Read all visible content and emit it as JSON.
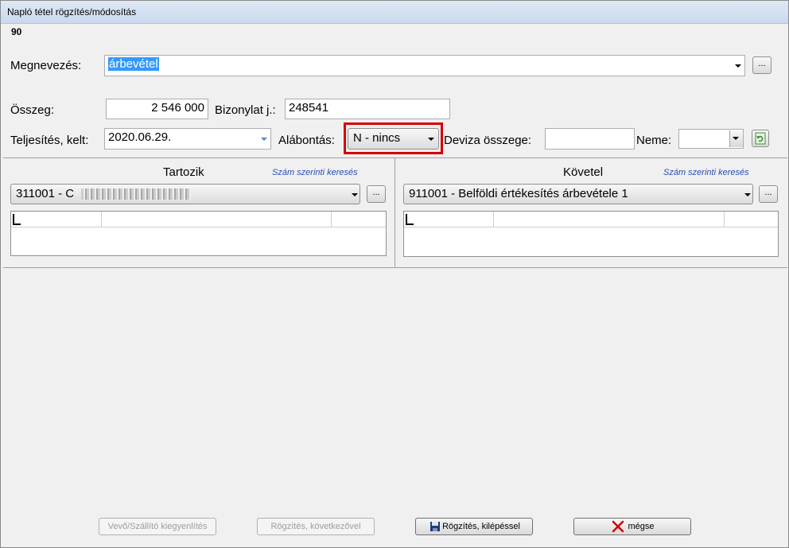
{
  "window": {
    "title": "Napló tétel rögzítés/módosítás"
  },
  "record_number": "90",
  "form": {
    "megnevezes_label": "Megnevezés:",
    "megnevezes_value": "árbevétel",
    "osszeg_label": "Összeg:",
    "osszeg_value": "2 546 000",
    "bizonylat_label": "Bizonylat j.:",
    "bizonylat_value": "248541",
    "teljesites_label": "Teljesítés, kelt:",
    "teljesites_value": "2020.06.29.",
    "alabontas_label": "Alábontás:",
    "alabontas_value": "N - nincs",
    "deviza_label": "Deviza összege:",
    "deviza_value": "",
    "neme_label": "Neme:",
    "neme_value": "",
    "dots_label": "..."
  },
  "tartozik": {
    "title": "Tartozik",
    "search_link": "Szám szerinti keresés",
    "account_value": "311001 - C"
  },
  "kovetel": {
    "title": "Követel",
    "search_link": "Szám szerinti keresés",
    "account_value": "911001 - Belföldi értékesítés árbevétele 1"
  },
  "buttons": {
    "vevo": "Vevő/Szállító kiegyenlítés",
    "rogzites_kov": "Rögzítés, következővel",
    "rogzites_kil": "Rögzítés, kilépéssel",
    "megse": "mégse"
  },
  "colors": {
    "highlight_border": "#d40000",
    "selection": "#3399ff",
    "link": "#2a4db4"
  }
}
